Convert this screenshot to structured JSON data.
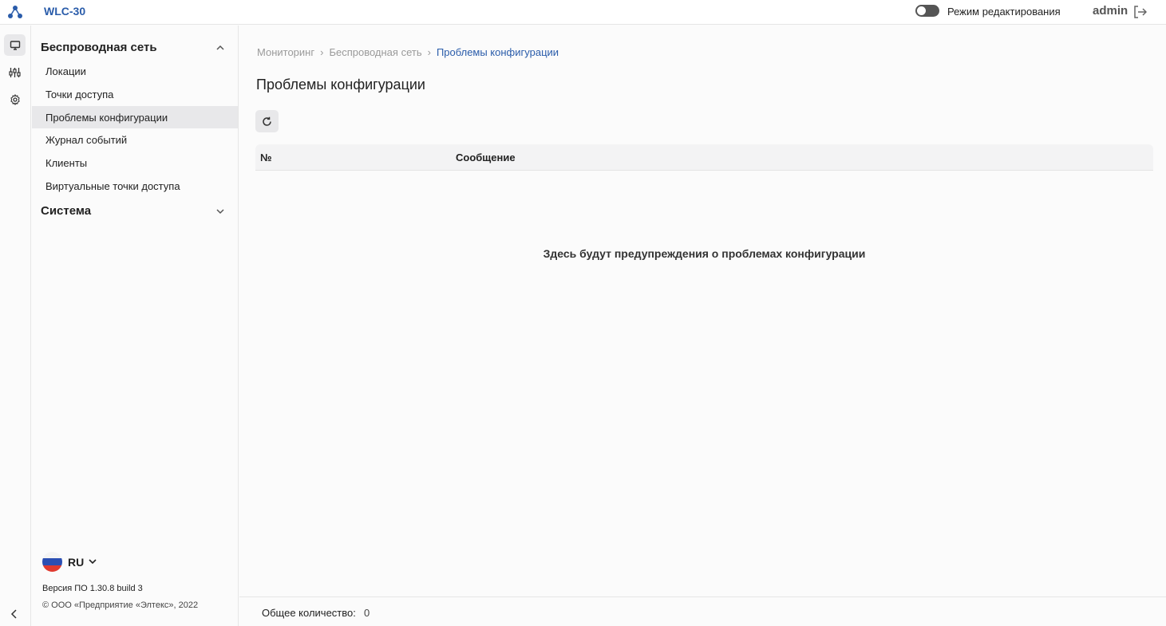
{
  "header": {
    "app_title": "WLC-30",
    "edit_mode_label": "Режим редактирования",
    "user": "admin"
  },
  "rail": {
    "icons": [
      "monitor-icon",
      "equalizer-icon",
      "settings-icon"
    ]
  },
  "sidebar": {
    "sections": [
      {
        "label": "Беспроводная сеть",
        "expanded": true,
        "items": [
          {
            "label": "Локации"
          },
          {
            "label": "Точки доступа"
          },
          {
            "label": "Проблемы конфигурации",
            "active": true
          },
          {
            "label": "Журнал событий"
          },
          {
            "label": "Клиенты"
          },
          {
            "label": "Виртуальные точки доступа"
          }
        ]
      },
      {
        "label": "Система",
        "expanded": false
      }
    ],
    "language": "RU",
    "version": "Версия ПО 1.30.8 build 3",
    "copyright": "© ООО «Предприятие «Элтекс», 2022"
  },
  "main": {
    "breadcrumb": [
      "Мониторинг",
      "Беспроводная сеть",
      "Проблемы конфигурации"
    ],
    "title": "Проблемы конфигурации",
    "table": {
      "columns": [
        "№",
        "Сообщение"
      ],
      "rows": [],
      "empty_message": "Здесь будут предупреждения о проблемах конфигурации"
    },
    "footer": {
      "total_label": "Общее количество:",
      "total_value": "0"
    }
  },
  "colors": {
    "accent": "#2a5caa",
    "active_bg": "#e8e8ea"
  }
}
